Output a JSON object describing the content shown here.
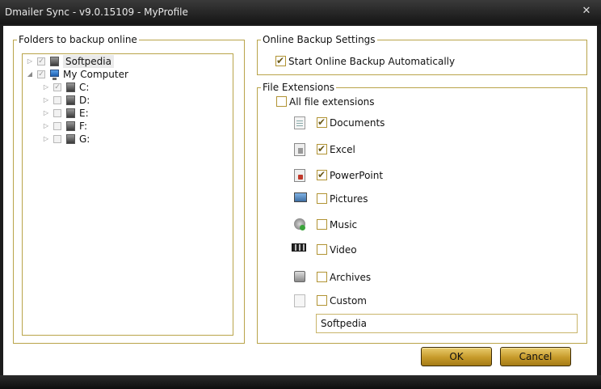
{
  "window": {
    "title": "Dmailer Sync - v9.0.15109 - MyProfile",
    "close_glyph": "✕"
  },
  "folders": {
    "legend": "Folders to backup online",
    "tree": [
      {
        "label": "Softpedia",
        "level": 0,
        "expander": "▷",
        "checked": true,
        "icon": "drive-icon",
        "selected": true
      },
      {
        "label": "My Computer",
        "level": 0,
        "expander": "◢",
        "checked": true,
        "icon": "computer-icon",
        "selected": false
      },
      {
        "label": "C:",
        "level": 1,
        "expander": "▷",
        "checked": true,
        "icon": "drive-icon",
        "selected": false
      },
      {
        "label": "D:",
        "level": 1,
        "expander": "▷",
        "checked": false,
        "icon": "drive-icon",
        "selected": false
      },
      {
        "label": "E:",
        "level": 1,
        "expander": "▷",
        "checked": false,
        "icon": "drive-icon",
        "selected": false
      },
      {
        "label": "F:",
        "level": 1,
        "expander": "▷",
        "checked": false,
        "icon": "drive-icon",
        "selected": false
      },
      {
        "label": "G:",
        "level": 1,
        "expander": "▷",
        "checked": false,
        "icon": "drive-icon",
        "selected": false
      }
    ]
  },
  "online_backup": {
    "legend": "Online Backup Settings",
    "start_auto": {
      "label": "Start Online Backup Automatically",
      "checked": true
    }
  },
  "file_extensions": {
    "legend": "File Extensions",
    "all": {
      "label": "All file extensions",
      "checked": false
    },
    "items": [
      {
        "label": "Documents",
        "checked": true,
        "icon": "document-icon"
      },
      {
        "label": "Excel",
        "checked": true,
        "icon": "excel-icon"
      },
      {
        "label": "PowerPoint",
        "checked": true,
        "icon": "powerpoint-icon"
      },
      {
        "label": "Pictures",
        "checked": false,
        "icon": "pictures-icon"
      },
      {
        "label": "Music",
        "checked": false,
        "icon": "music-icon"
      },
      {
        "label": "Video",
        "checked": false,
        "icon": "video-icon"
      },
      {
        "label": "Archives",
        "checked": false,
        "icon": "archive-icon"
      },
      {
        "label": "Custom",
        "checked": false,
        "icon": "custom-file-icon"
      }
    ],
    "custom_value": "Softpedia"
  },
  "buttons": {
    "ok": "OK",
    "cancel": "Cancel"
  },
  "colors": {
    "frame": "#1c1c1c",
    "group_border": "#b9a44a",
    "button_gold": "#c69a2a"
  }
}
